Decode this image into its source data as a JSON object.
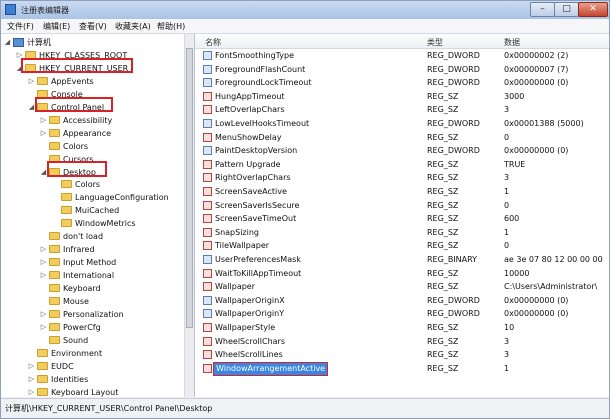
{
  "window": {
    "title": "注册表编辑器",
    "min_glyph": "–",
    "max_glyph": "□",
    "close_glyph": "✕"
  },
  "menu": [
    "文件(F)",
    "编辑(E)",
    "查看(V)",
    "收藏夹(A)",
    "帮助(H)"
  ],
  "columns": {
    "name": "名称",
    "type": "类型",
    "data": "数据"
  },
  "tree": [
    {
      "label": "计算机",
      "depth": 0,
      "expander": "◢",
      "icon": "computer"
    },
    {
      "label": "HKEY_CLASSES_ROOT",
      "depth": 1,
      "expander": "▷",
      "icon": "folder"
    },
    {
      "label": "HKEY_CURRENT_USER",
      "depth": 1,
      "expander": "◢",
      "icon": "folder"
    },
    {
      "label": "AppEvents",
      "depth": 2,
      "expander": "▷",
      "icon": "folder"
    },
    {
      "label": "Console",
      "depth": 2,
      "expander": "",
      "icon": "folder"
    },
    {
      "label": "Control Panel",
      "depth": 2,
      "expander": "◢",
      "icon": "folder"
    },
    {
      "label": "Accessibility",
      "depth": 3,
      "expander": "▷",
      "icon": "folder"
    },
    {
      "label": "Appearance",
      "depth": 3,
      "expander": "▷",
      "icon": "folder"
    },
    {
      "label": "Colors",
      "depth": 3,
      "expander": "",
      "icon": "folder"
    },
    {
      "label": "Cursors",
      "depth": 3,
      "expander": "",
      "icon": "folder"
    },
    {
      "label": "Desktop",
      "depth": 3,
      "expander": "◢",
      "icon": "folder"
    },
    {
      "label": "Colors",
      "depth": 4,
      "expander": "",
      "icon": "folder"
    },
    {
      "label": "LanguageConfiguration",
      "depth": 4,
      "expander": "",
      "icon": "folder"
    },
    {
      "label": "MuiCached",
      "depth": 4,
      "expander": "",
      "icon": "folder"
    },
    {
      "label": "WindowMetrics",
      "depth": 4,
      "expander": "",
      "icon": "folder"
    },
    {
      "label": "don't load",
      "depth": 3,
      "expander": "",
      "icon": "folder"
    },
    {
      "label": "Infrared",
      "depth": 3,
      "expander": "▷",
      "icon": "folder"
    },
    {
      "label": "Input Method",
      "depth": 3,
      "expander": "▷",
      "icon": "folder"
    },
    {
      "label": "International",
      "depth": 3,
      "expander": "▷",
      "icon": "folder"
    },
    {
      "label": "Keyboard",
      "depth": 3,
      "expander": "",
      "icon": "folder"
    },
    {
      "label": "Mouse",
      "depth": 3,
      "expander": "",
      "icon": "folder"
    },
    {
      "label": "Personalization",
      "depth": 3,
      "expander": "▷",
      "icon": "folder"
    },
    {
      "label": "PowerCfg",
      "depth": 3,
      "expander": "▷",
      "icon": "folder"
    },
    {
      "label": "Sound",
      "depth": 3,
      "expander": "",
      "icon": "folder"
    },
    {
      "label": "Environment",
      "depth": 2,
      "expander": "",
      "icon": "folder"
    },
    {
      "label": "EUDC",
      "depth": 2,
      "expander": "▷",
      "icon": "folder"
    },
    {
      "label": "Identities",
      "depth": 2,
      "expander": "▷",
      "icon": "folder"
    },
    {
      "label": "Keyboard Layout",
      "depth": 2,
      "expander": "▷",
      "icon": "folder"
    }
  ],
  "values": [
    {
      "name": "FontSmoothingType",
      "type": "REG_DWORD",
      "data": "0x00000002 (2)"
    },
    {
      "name": "ForegroundFlashCount",
      "type": "REG_DWORD",
      "data": "0x00000007 (7)"
    },
    {
      "name": "ForegroundLockTimeout",
      "type": "REG_DWORD",
      "data": "0x00000000 (0)"
    },
    {
      "name": "HungAppTimeout",
      "type": "REG_SZ",
      "data": "3000"
    },
    {
      "name": "LeftOverlapChars",
      "type": "REG_SZ",
      "data": "3"
    },
    {
      "name": "LowLevelHooksTimeout",
      "type": "REG_DWORD",
      "data": "0x00001388 (5000)"
    },
    {
      "name": "MenuShowDelay",
      "type": "REG_SZ",
      "data": "0"
    },
    {
      "name": "PaintDesktopVersion",
      "type": "REG_DWORD",
      "data": "0x00000000 (0)"
    },
    {
      "name": "Pattern Upgrade",
      "type": "REG_SZ",
      "data": "TRUE"
    },
    {
      "name": "RightOverlapChars",
      "type": "REG_SZ",
      "data": "3"
    },
    {
      "name": "ScreenSaveActive",
      "type": "REG_SZ",
      "data": "1"
    },
    {
      "name": "ScreenSaverIsSecure",
      "type": "REG_SZ",
      "data": "0"
    },
    {
      "name": "ScreenSaveTimeOut",
      "type": "REG_SZ",
      "data": "600"
    },
    {
      "name": "SnapSizing",
      "type": "REG_SZ",
      "data": "1"
    },
    {
      "name": "TileWallpaper",
      "type": "REG_SZ",
      "data": "0"
    },
    {
      "name": "UserPreferencesMask",
      "type": "REG_BINARY",
      "data": "ae 3e 07 80 12 00 00 00"
    },
    {
      "name": "WaitToKillAppTimeout",
      "type": "REG_SZ",
      "data": "10000"
    },
    {
      "name": "Wallpaper",
      "type": "REG_SZ",
      "data": "C:\\Users\\Administrator\\"
    },
    {
      "name": "WallpaperOriginX",
      "type": "REG_DWORD",
      "data": "0x00000000 (0)"
    },
    {
      "name": "WallpaperOriginY",
      "type": "REG_DWORD",
      "data": "0x00000000 (0)"
    },
    {
      "name": "WallpaperStyle",
      "type": "REG_SZ",
      "data": "10"
    },
    {
      "name": "WheelScrollChars",
      "type": "REG_SZ",
      "data": "3"
    },
    {
      "name": "WheelScrollLines",
      "type": "REG_SZ",
      "data": "3"
    },
    {
      "name": "WindowArrangementActive",
      "type": "REG_SZ",
      "data": "1"
    }
  ],
  "status": "计算机\\HKEY_CURRENT_USER\\Control Panel\\Desktop",
  "colors": {
    "highlight": "#d8222a",
    "selection": "#3a86e0"
  }
}
